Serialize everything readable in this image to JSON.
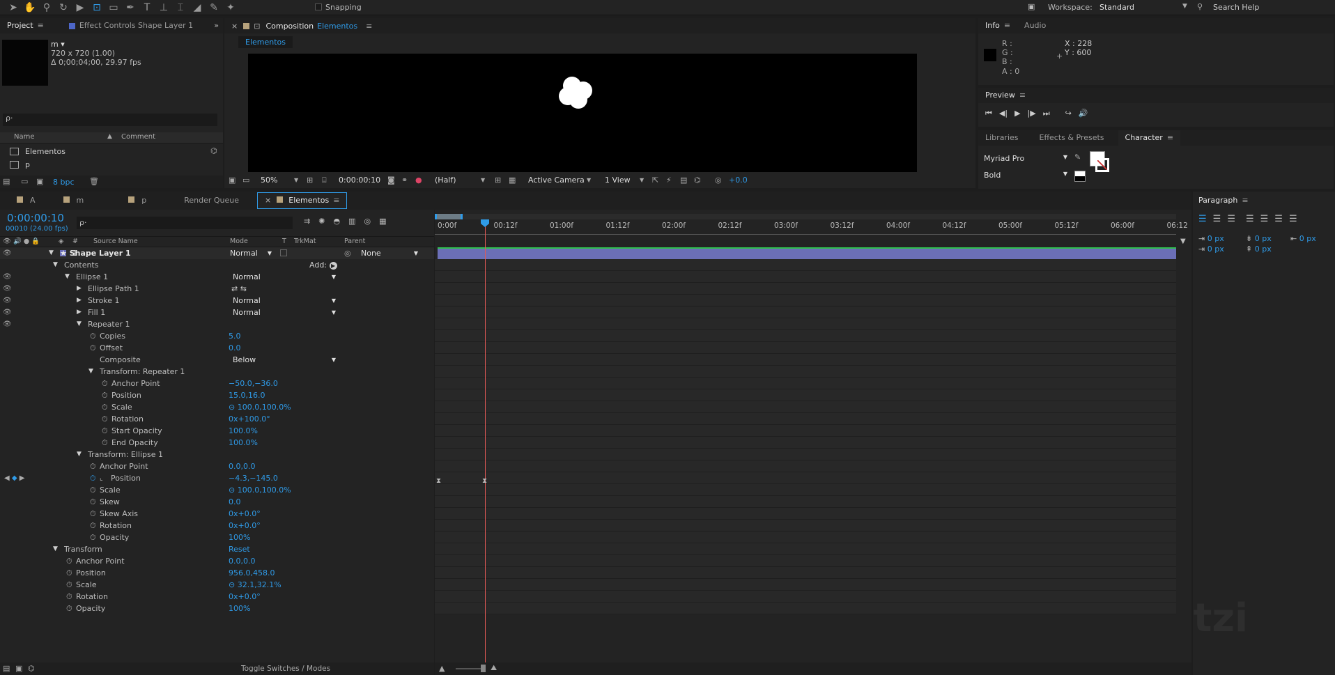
{
  "toolbar": {
    "snapping": "Snapping",
    "workspace_label": "Workspace:",
    "workspace_value": "Standard",
    "search_help": "Search Help"
  },
  "project": {
    "tab_project": "Project",
    "tab_effect_controls": "Effect Controls Shape Layer 1",
    "item_name": "m ▾",
    "item_size": "720 x 720 (1.00)",
    "item_duration": "Δ 0;00;04;00, 29.97 fps",
    "search_placeholder": "ρ·",
    "col_name": "Name",
    "col_comment": "Comment",
    "items": [
      "Elementos",
      "p"
    ],
    "bpc": "8 bpc"
  },
  "composition": {
    "close": "×",
    "lock": "🔒",
    "title_prefix": "Composition",
    "title_name": "Elementos",
    "breadcrumb": "Elementos",
    "zoom": "50%",
    "timecode": "0:00:00:10",
    "resolution": "(Half)",
    "camera": "Active Camera",
    "views": "1 View",
    "exposure": "+0.0"
  },
  "info": {
    "tab_info": "Info",
    "tab_audio": "Audio",
    "r": "R :",
    "g": "G :",
    "b": "B :",
    "a": "A : 0",
    "x": "X : 228",
    "y": "Y : 600"
  },
  "preview": {
    "title": "Preview"
  },
  "character": {
    "tab_libraries": "Libraries",
    "tab_effects": "Effects & Presets",
    "tab_character": "Character",
    "font": "Myriad Pro",
    "style": "Bold"
  },
  "paragraph": {
    "title": "Paragraph",
    "v1": "0 px",
    "v2": "0 px",
    "v3": "0 px",
    "v4": "0 px",
    "v5": "0 px"
  },
  "timeline_tabs": [
    "A",
    "m",
    "p",
    "Render Queue",
    "Elementos"
  ],
  "timeline": {
    "timecode": "0:00:00:10",
    "frames": "00010 (24.00 fps)",
    "search": "ρ·",
    "col_num": "#",
    "col_source": "Source Name",
    "col_mode": "Mode",
    "col_t": "T",
    "col_trkmat": "TrkMat",
    "col_parent": "Parent",
    "ruler": [
      "0:00f",
      "00:12f",
      "01:00f",
      "01:12f",
      "02:00f",
      "02:12f",
      "03:00f",
      "03:12f",
      "04:00f",
      "04:12f",
      "05:00f",
      "05:12f",
      "06:00f",
      "06:12"
    ],
    "toggle": "Toggle Switches / Modes"
  },
  "layers": [
    {
      "indent": 0,
      "tri": "▼",
      "num": "1",
      "name": "★  Shape Layer 1",
      "bold": true,
      "mode": "Normal",
      "parent": "None"
    },
    {
      "indent": 1,
      "tri": "▼",
      "name": "Contents",
      "add": "Add:"
    },
    {
      "indent": 2,
      "tri": "▼",
      "name": "Ellipse 1",
      "mode": "Normal",
      "eye": true
    },
    {
      "indent": 3,
      "tri": "▶",
      "name": "Ellipse Path 1",
      "eye": true,
      "icons": "⇄ ⇆"
    },
    {
      "indent": 3,
      "tri": "▶",
      "name": "Stroke 1",
      "mode": "Normal",
      "eye": true
    },
    {
      "indent": 3,
      "tri": "▶",
      "name": "Fill 1",
      "mode": "Normal",
      "eye": true
    },
    {
      "indent": 3,
      "tri": "▼",
      "name": "Repeater 1",
      "eye": true
    },
    {
      "indent": 4,
      "sw": true,
      "name": "Copies",
      "value": "5.0"
    },
    {
      "indent": 4,
      "sw": true,
      "name": "Offset",
      "value": "0.0"
    },
    {
      "indent": 4,
      "name": "Composite",
      "mode": "Below"
    },
    {
      "indent": 4,
      "tri": "▼",
      "name": "Transform: Repeater 1"
    },
    {
      "indent": 5,
      "sw": true,
      "name": "Anchor Point",
      "value": "−50.0,−36.0"
    },
    {
      "indent": 5,
      "sw": true,
      "name": "Position",
      "value": "15.0,16.0"
    },
    {
      "indent": 5,
      "sw": true,
      "name": "Scale",
      "value": "⊝ 100.0,100.0%"
    },
    {
      "indent": 5,
      "sw": true,
      "name": "Rotation",
      "value": "0x+100.0°"
    },
    {
      "indent": 5,
      "sw": true,
      "name": "Start Opacity",
      "value": "100.0%"
    },
    {
      "indent": 5,
      "sw": true,
      "name": "End Opacity",
      "value": "100.0%"
    },
    {
      "indent": 3,
      "tri": "▼",
      "name": "Transform: Ellipse 1"
    },
    {
      "indent": 4,
      "sw": true,
      "name": "Anchor Point",
      "value": "0.0,0.0"
    },
    {
      "indent": 4,
      "sw": true,
      "name": "Position",
      "value": "−4.3,−145.0",
      "keyed": true
    },
    {
      "indent": 4,
      "sw": true,
      "name": "Scale",
      "value": "⊝ 100.0,100.0%"
    },
    {
      "indent": 4,
      "sw": true,
      "name": "Skew",
      "value": "0.0"
    },
    {
      "indent": 4,
      "sw": true,
      "name": "Skew Axis",
      "value": "0x+0.0°"
    },
    {
      "indent": 4,
      "sw": true,
      "name": "Rotation",
      "value": "0x+0.0°"
    },
    {
      "indent": 4,
      "sw": true,
      "name": "Opacity",
      "value": "100%"
    },
    {
      "indent": 1,
      "tri": "▼",
      "name": "Transform",
      "value": "Reset"
    },
    {
      "indent": 2,
      "sw": true,
      "name": "Anchor Point",
      "value": "0.0,0.0"
    },
    {
      "indent": 2,
      "sw": true,
      "name": "Position",
      "value": "956.0,458.0"
    },
    {
      "indent": 2,
      "sw": true,
      "name": "Scale",
      "value": "⊝ 32.1,32.1%"
    },
    {
      "indent": 2,
      "sw": true,
      "name": "Rotation",
      "value": "0x+0.0°"
    },
    {
      "indent": 2,
      "sw": true,
      "name": "Opacity",
      "value": "100%"
    }
  ],
  "watermark": "Platzi"
}
